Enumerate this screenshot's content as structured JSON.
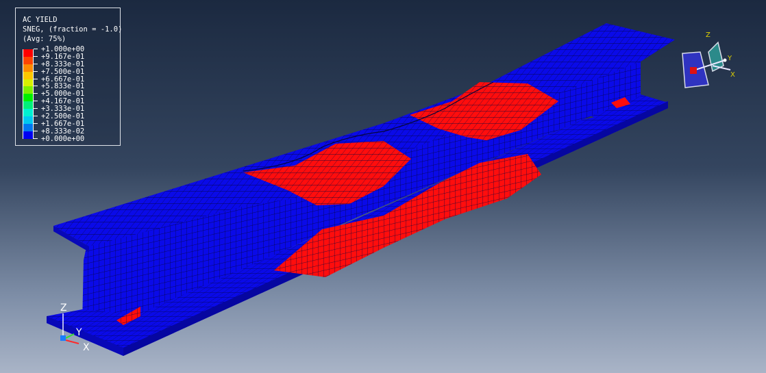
{
  "legend": {
    "title": "AC YIELD",
    "variable": "SNEG, (fraction = -1.0)",
    "averaging": "(Avg: 75%)",
    "entries": [
      {
        "value": "+1.000e+00",
        "color": "#ff0000"
      },
      {
        "value": "+9.167e-01",
        "color": "#ff4400"
      },
      {
        "value": "+8.333e-01",
        "color": "#ff8a00"
      },
      {
        "value": "+7.500e-01",
        "color": "#ffc800"
      },
      {
        "value": "+6.667e-01",
        "color": "#d8f000"
      },
      {
        "value": "+5.833e-01",
        "color": "#7ef000"
      },
      {
        "value": "+5.000e-01",
        "color": "#00f000"
      },
      {
        "value": "+4.167e-01",
        "color": "#00f07a"
      },
      {
        "value": "+3.333e-01",
        "color": "#00f0d0"
      },
      {
        "value": "+2.500e-01",
        "color": "#00c8f0"
      },
      {
        "value": "+1.667e-01",
        "color": "#0078f0"
      },
      {
        "value": "+8.333e-02",
        "color": "#0000f0"
      },
      {
        "value": "+0.000e+00",
        "color": null
      }
    ]
  },
  "colors": {
    "low": "#0a0ae8",
    "high": "#ff0d0d",
    "mesh_line": "#06063a",
    "background_top": "#1b2940",
    "background_bottom": "#a9b4c7"
  },
  "triad": {
    "x": "X",
    "y": "Y",
    "z": "Z"
  },
  "view_triad": {
    "x": "X",
    "y": "Y",
    "z": "Z"
  }
}
